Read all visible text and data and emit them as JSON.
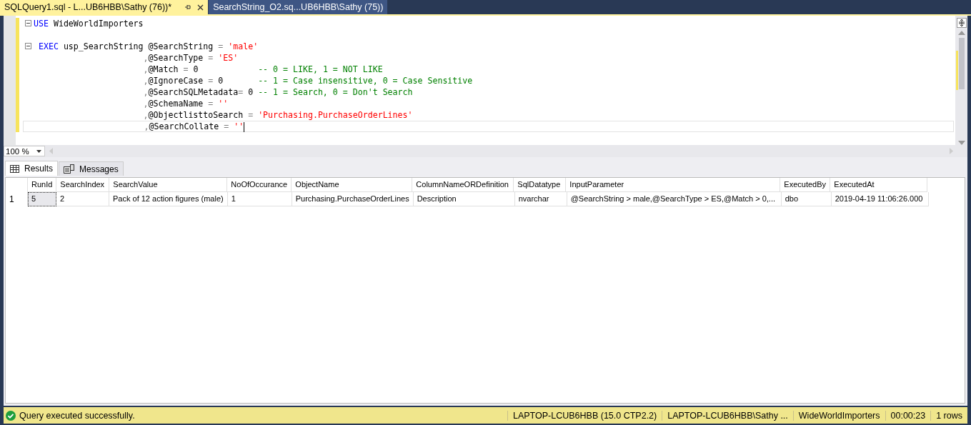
{
  "tabs": [
    {
      "label": "SQLQuery1.sql - L...UB6HBB\\Sathy (76))*",
      "selected": true
    },
    {
      "label": "SearchString_O2.sq...UB6HBB\\Sathy (75))",
      "selected": false
    }
  ],
  "editor": {
    "lines": [
      {
        "fold": true,
        "current": false,
        "tokens": [
          {
            "kind": "keyword",
            "text": "USE"
          },
          {
            "kind": "ident",
            "text": " WideWorldImporters"
          }
        ]
      },
      {
        "fold": false,
        "current": false
      },
      {
        "fold": true,
        "current": false,
        "tokens": [
          {
            "kind": "keyword",
            "text": " EXEC"
          },
          {
            "kind": "ident",
            "text": " usp_SearchString @SearchString "
          },
          {
            "kind": "op",
            "text": "= "
          },
          {
            "kind": "string",
            "text": "'male'"
          }
        ]
      },
      {
        "fold": false,
        "current": false,
        "tokens": [
          {
            "kind": "op",
            "text": "                      ,"
          },
          {
            "kind": "ident",
            "text": "@SearchType "
          },
          {
            "kind": "op",
            "text": "= "
          },
          {
            "kind": "string",
            "text": "'ES'"
          }
        ]
      },
      {
        "fold": false,
        "current": false,
        "tokens": [
          {
            "kind": "op",
            "text": "                      ,"
          },
          {
            "kind": "ident",
            "text": "@Match "
          },
          {
            "kind": "op",
            "text": "="
          },
          {
            "kind": "ident",
            "text": " 0            "
          },
          {
            "kind": "comment",
            "text": "-- 0 = LIKE, 1 = NOT LIKE"
          }
        ]
      },
      {
        "fold": false,
        "current": false,
        "tokens": [
          {
            "kind": "op",
            "text": "                      ,"
          },
          {
            "kind": "ident",
            "text": "@IgnoreCase "
          },
          {
            "kind": "op",
            "text": "="
          },
          {
            "kind": "ident",
            "text": " 0       "
          },
          {
            "kind": "comment",
            "text": "-- 1 = Case insensitive, 0 = Case Sensitive"
          }
        ]
      },
      {
        "fold": false,
        "current": false,
        "tokens": [
          {
            "kind": "op",
            "text": "                      ,"
          },
          {
            "kind": "ident",
            "text": "@SearchSQLMetadata"
          },
          {
            "kind": "op",
            "text": "="
          },
          {
            "kind": "ident",
            "text": " 0 "
          },
          {
            "kind": "comment",
            "text": "-- 1 = Search, 0 = Don't Search"
          }
        ]
      },
      {
        "fold": false,
        "current": false,
        "tokens": [
          {
            "kind": "op",
            "text": "                      ,"
          },
          {
            "kind": "ident",
            "text": "@SchemaName "
          },
          {
            "kind": "op",
            "text": "= "
          },
          {
            "kind": "string",
            "text": "''"
          }
        ]
      },
      {
        "fold": false,
        "current": false,
        "tokens": [
          {
            "kind": "op",
            "text": "                      ,"
          },
          {
            "kind": "ident",
            "text": "@ObjectlisttoSearch "
          },
          {
            "kind": "op",
            "text": "= "
          },
          {
            "kind": "string",
            "text": "'Purchasing.PurchaseOrderLines'"
          }
        ]
      },
      {
        "fold": false,
        "current": true,
        "tokens": [
          {
            "kind": "op",
            "text": "                      ,"
          },
          {
            "kind": "ident",
            "text": "@SearchCollate "
          },
          {
            "kind": "op",
            "text": "= "
          },
          {
            "kind": "string",
            "text": "''"
          }
        ]
      }
    ]
  },
  "zoom": "100 %",
  "result_tabs": [
    {
      "label": "Results",
      "kind": "grid",
      "selected": true
    },
    {
      "label": "Messages",
      "kind": "messages",
      "selected": false
    }
  ],
  "grid": {
    "columns": [
      "RunId",
      "SearchIndex",
      "SearchValue",
      "NoOfOccurance",
      "ObjectName",
      "ColumnNameORDefinition",
      "SqlDatatype",
      "InputParameter",
      "ExecutedBy",
      "ExecutedAt"
    ],
    "rows": [
      {
        "number": "1",
        "cells": [
          {
            "text": "5",
            "selected": true
          },
          {
            "text": "2",
            "selected": false
          },
          {
            "text": "Pack of 12 action figures (male)",
            "selected": false
          },
          {
            "text": "1",
            "selected": false
          },
          {
            "text": "Purchasing.PurchaseOrderLines",
            "selected": false
          },
          {
            "text": "Description",
            "selected": false
          },
          {
            "text": "nvarchar",
            "selected": false
          },
          {
            "text": "@SearchString > male,@SearchType > ES,@Match > 0,...",
            "selected": false
          },
          {
            "text": "dbo",
            "selected": false
          },
          {
            "text": "2019-04-19 11:06:26.000",
            "selected": false
          }
        ]
      }
    ]
  },
  "status_bar": {
    "message": "Query executed successfully.",
    "segments": [
      "LAPTOP-LCUB6HBB (15.0 CTP2.2)",
      "LAPTOP-LCUB6HBB\\Sathy ...",
      "WideWorldImporters",
      "00:00:23",
      "1 rows"
    ]
  }
}
